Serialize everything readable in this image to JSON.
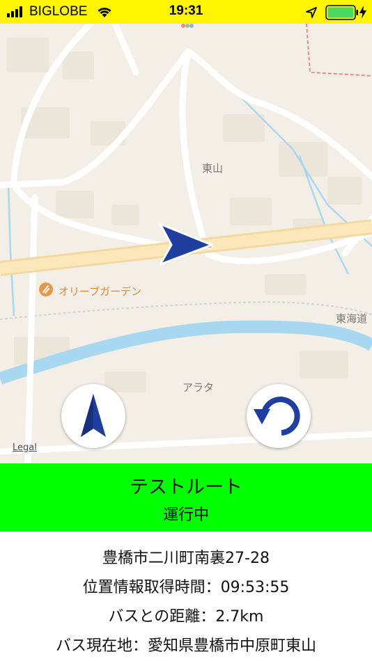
{
  "status_bar": {
    "carrier": "BIGLOBE",
    "time": "19:31",
    "icons": [
      "signal-icon",
      "wifi-icon",
      "location-arrow-icon",
      "battery-icon",
      "charging-icon"
    ],
    "battery_color": "#4CD964"
  },
  "map": {
    "labels": {
      "higashiyama": "東山",
      "olive_garden": "オリーブガーデン",
      "tokaido": "東海道",
      "arata": "アラタ"
    },
    "legal": "Legal",
    "colors": {
      "land": "#F4EFE6",
      "road": "#FFFFFF",
      "highway": "#FBE3B0",
      "water": "#A8D8F0",
      "arrow": "#1E3FA0"
    },
    "buttons": {
      "compass": "north-arrow-icon",
      "refresh": "refresh-icon"
    }
  },
  "route_panel": {
    "name": "テストルート",
    "status": "運行中",
    "background": "#00FF00"
  },
  "info": {
    "address": "豊橋市二川町南裏27-28",
    "acquired_time": "位置情報取得時間：09:53:55",
    "distance": "バスとの距離：2.7km",
    "current_location": "バス現在地：愛知県豊橋市中原町東山"
  }
}
